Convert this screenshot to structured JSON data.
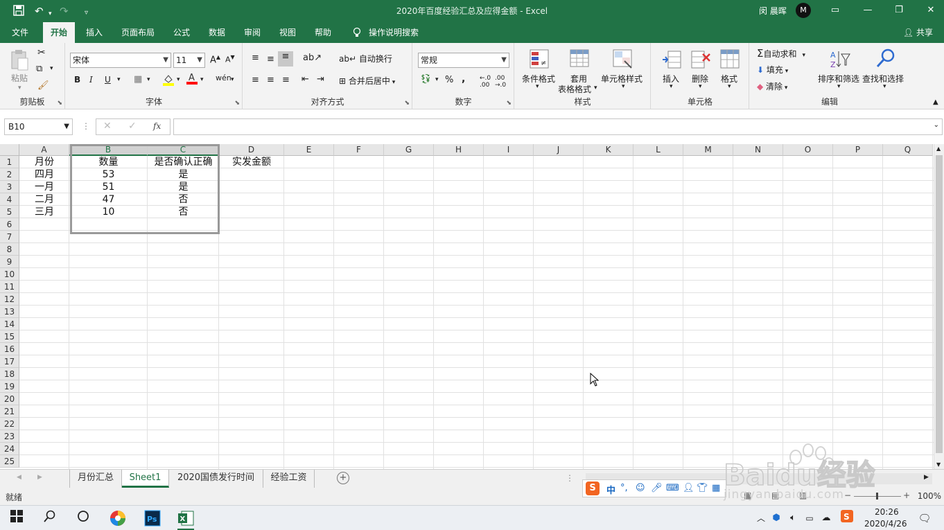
{
  "window": {
    "title": "2020年百度经验汇总及应得金额  -  Excel",
    "user_name": "闵 晨晖",
    "user_initial": "M"
  },
  "ribbon_tabs": [
    "文件",
    "开始",
    "插入",
    "页面布局",
    "公式",
    "数据",
    "审阅",
    "视图",
    "帮助"
  ],
  "active_tab": "开始",
  "tell_me": "操作说明搜索",
  "share_label": "共享",
  "ribbon": {
    "clipboard": {
      "paste": "粘贴",
      "label": "剪贴板"
    },
    "font": {
      "name": "宋体",
      "size": "11",
      "bold": "B",
      "italic": "I",
      "underline": "U",
      "label": "字体"
    },
    "alignment": {
      "wrap": "自动换行",
      "merge": "合并后居中",
      "label": "对齐方式"
    },
    "number": {
      "format": "常规",
      "percent": "%",
      "comma": ",",
      "label": "数字"
    },
    "styles": {
      "conditional": "条件格式",
      "table_line1": "套用",
      "table_line2": "表格格式",
      "cell_styles": "单元格样式",
      "label": "样式"
    },
    "cells": {
      "insert": "插入",
      "delete": "删除",
      "format": "格式",
      "label": "单元格"
    },
    "editing": {
      "autosum": "自动求和",
      "fill": "填充",
      "clear": "清除",
      "sort": "排序和筛选",
      "find": "查找和选择",
      "label": "编辑"
    }
  },
  "formula_bar": {
    "name_box": "B10",
    "fx": "fx",
    "formula": ""
  },
  "columns": [
    "A",
    "B",
    "C",
    "D",
    "E",
    "F",
    "G",
    "H",
    "I",
    "J",
    "K",
    "L",
    "M",
    "N",
    "O",
    "P",
    "Q"
  ],
  "rows": [
    "1",
    "2",
    "3",
    "4",
    "5",
    "6",
    "7",
    "8",
    "9",
    "10",
    "11",
    "12",
    "13",
    "14",
    "15",
    "16",
    "17",
    "18",
    "19",
    "20",
    "21",
    "22",
    "23",
    "24",
    "25"
  ],
  "cells": {
    "A1": "月份",
    "B1": "数量",
    "C1": "是否确认正确",
    "D1": "实发金额",
    "A2": "四月",
    "B2": "53",
    "C2": "是",
    "A3": "一月",
    "B3": "51",
    "C3": "是",
    "A4": "二月",
    "B4": "47",
    "C4": "否",
    "A5": "三月",
    "B5": "10",
    "C5": "否"
  },
  "sheet_tabs": [
    "月份汇总",
    "Sheet1",
    "2020国债发行时间",
    "经验工资"
  ],
  "active_sheet": "Sheet1",
  "status": {
    "ready": "就绪",
    "zoom": "100%"
  },
  "ime": {
    "mode": "中"
  },
  "clock": {
    "time": "20:26",
    "date": "2020/4/26"
  },
  "watermark": {
    "brand": "Baidu经验",
    "url": "jingyan.baidu.com"
  },
  "colors": {
    "excel_green": "#217346",
    "ribbon_bg": "#f3f3f3",
    "grid_line": "#e1e1e1"
  }
}
